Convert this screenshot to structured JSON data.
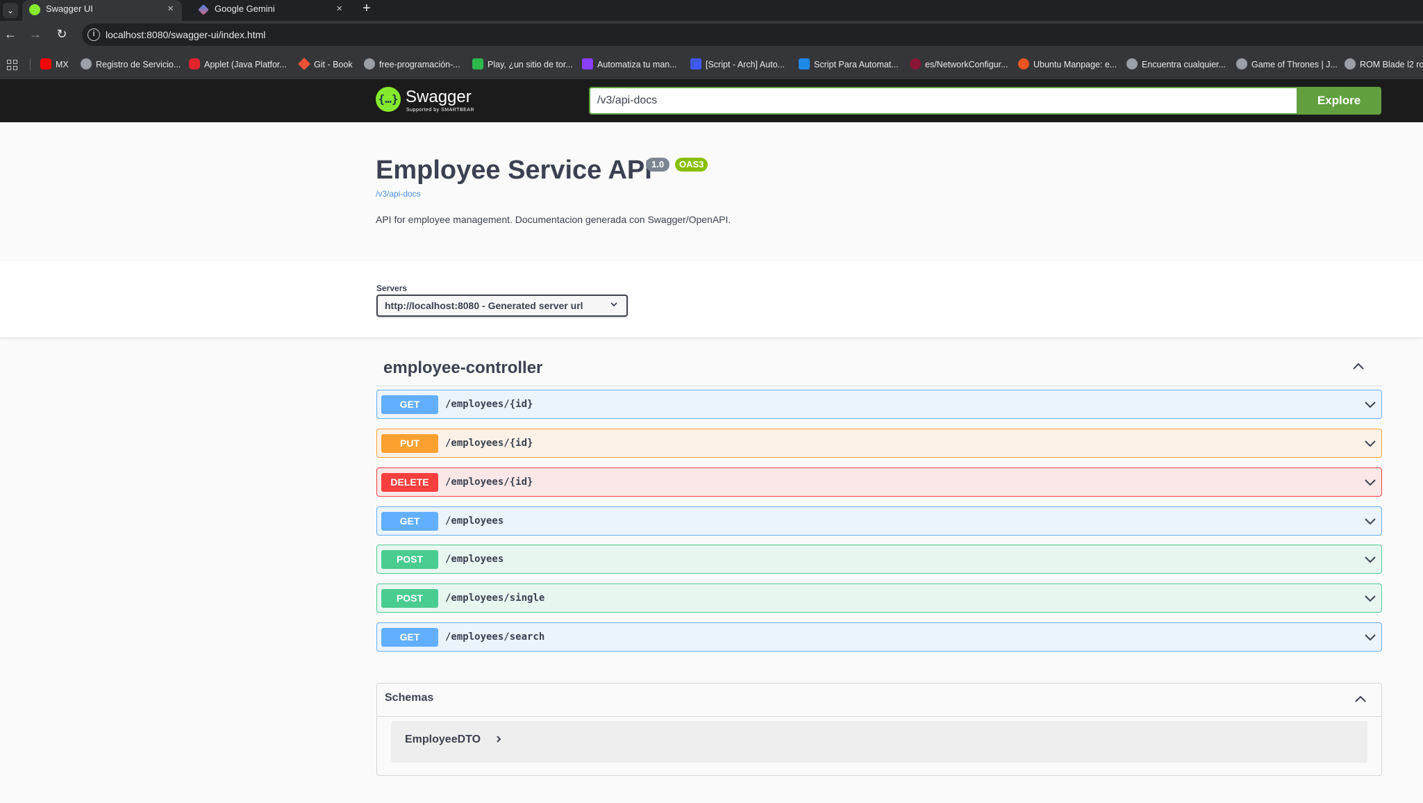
{
  "browser": {
    "tabs": [
      {
        "title": "Swagger UI",
        "active": true
      },
      {
        "title": "Google Gemini",
        "active": false
      }
    ],
    "close_glyph": "×",
    "new_tab_glyph": "+",
    "url": "localhost:8080/swagger-ui/index.html",
    "bookmarks": [
      {
        "label": "MX",
        "color": "#ff0000"
      },
      {
        "label": "Registro de Servicio...",
        "color": "#9aa0a6"
      },
      {
        "label": "Applet (Java Platfor...",
        "color": "#e0242a"
      },
      {
        "label": "Git - Book",
        "color": "#f05133"
      },
      {
        "label": "free-programación-...",
        "color": "#9aa0a6"
      },
      {
        "label": "Play, ¿un sitio de tor...",
        "color": "#2db84c"
      },
      {
        "label": "Automatiza tu man...",
        "color": "#8a3ffc"
      },
      {
        "label": "[Script - Arch] Auto...",
        "color": "#3d5afe"
      },
      {
        "label": "Script Para Automat...",
        "color": "#1e88e5"
      },
      {
        "label": "es/NetworkConfigur...",
        "color": "#8b1538"
      },
      {
        "label": "Ubuntu Manpage: e...",
        "color": "#e95420"
      },
      {
        "label": "Encuentra cualquier...",
        "color": "#9aa0a6"
      },
      {
        "label": "Game of Thrones | J...",
        "color": "#9aa0a6"
      },
      {
        "label": "ROM Blade l2 ro",
        "color": "#9aa0a6"
      }
    ]
  },
  "topbar": {
    "logo_text": "Swagger",
    "logo_sub": "Supported by SMARTBEAR",
    "spec_url": "/v3/api-docs",
    "explore_label": "Explore"
  },
  "info": {
    "title": "Employee Service API",
    "version": "1.0",
    "oas": "OAS3",
    "spec_link": "/v3/api-docs",
    "description": "API for employee management. Documentacion generada con Swagger/OpenAPI."
  },
  "servers": {
    "label": "Servers",
    "selected": "http://localhost:8080 - Generated server url"
  },
  "controller": {
    "name": "employee-controller",
    "operations": [
      {
        "method": "GET",
        "path": "/employees/{id}"
      },
      {
        "method": "PUT",
        "path": "/employees/{id}"
      },
      {
        "method": "DELETE",
        "path": "/employees/{id}"
      },
      {
        "method": "GET",
        "path": "/employees"
      },
      {
        "method": "POST",
        "path": "/employees"
      },
      {
        "method": "POST",
        "path": "/employees/single"
      },
      {
        "method": "GET",
        "path": "/employees/search"
      }
    ]
  },
  "schemas": {
    "title": "Schemas",
    "models": [
      {
        "name": "EmployeeDTO"
      }
    ]
  }
}
